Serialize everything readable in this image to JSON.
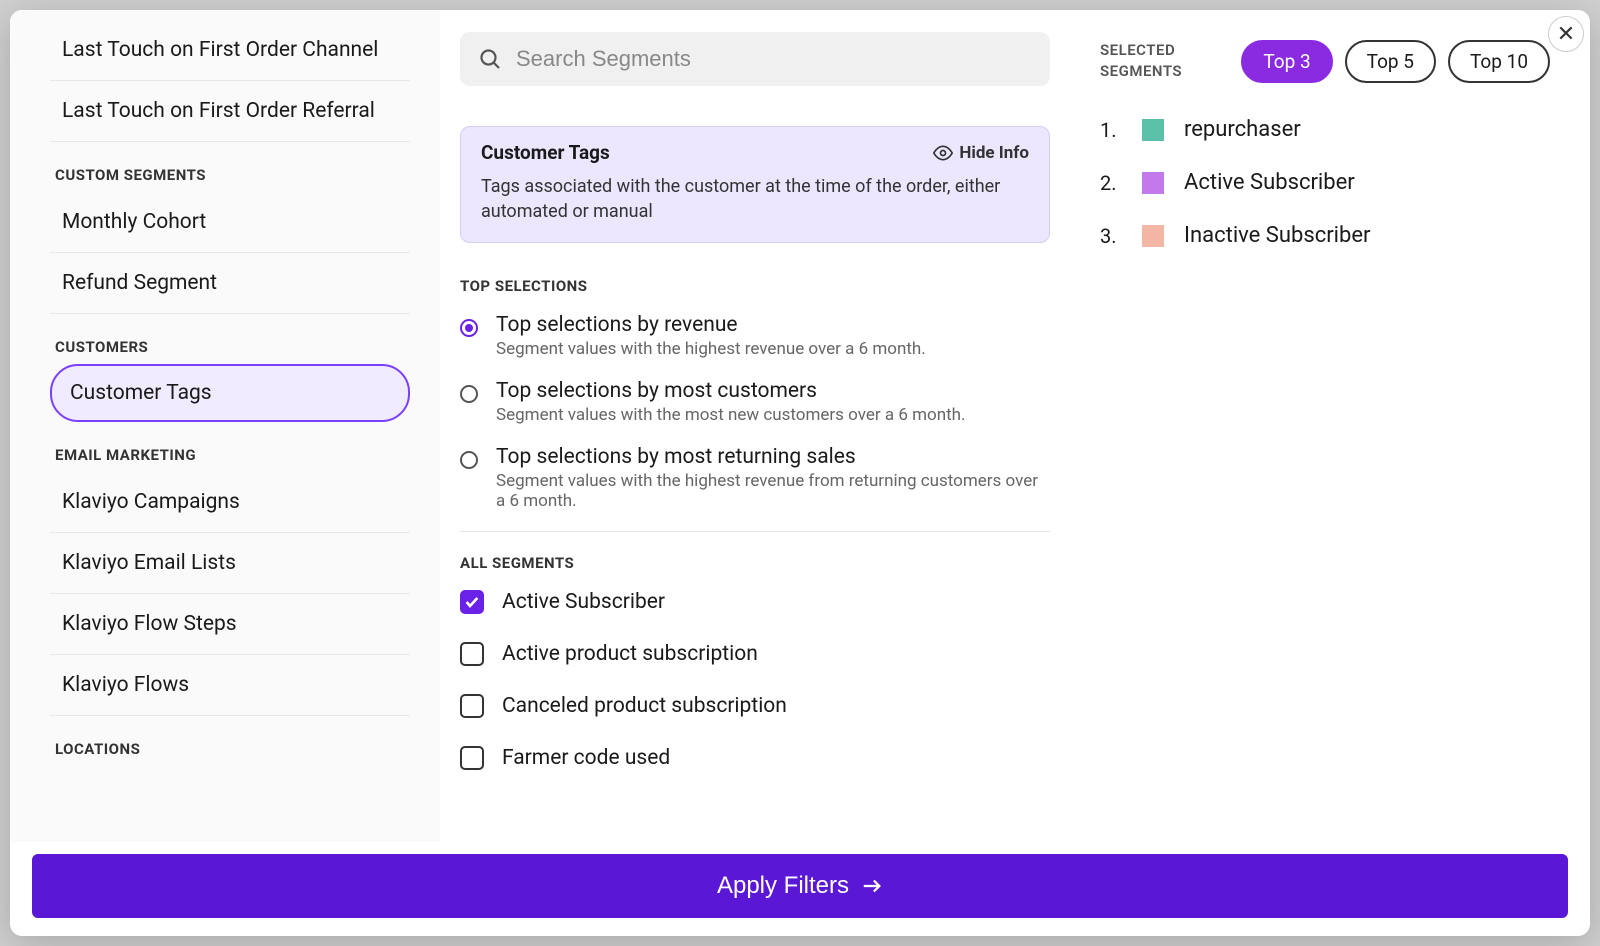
{
  "search": {
    "placeholder": "Search Segments"
  },
  "sidebar": {
    "items_top": [
      "Last Touch on First Order Channel",
      "Last Touch on First Order Referral"
    ],
    "heading_custom": "CUSTOM SEGMENTS",
    "items_custom": [
      "Monthly Cohort",
      "Refund Segment"
    ],
    "heading_customers": "CUSTOMERS",
    "item_customers_active": "Customer Tags",
    "heading_email": "EMAIL MARKETING",
    "items_email": [
      "Klaviyo Campaigns",
      "Klaviyo Email Lists",
      "Klaviyo Flow Steps",
      "Klaviyo Flows"
    ],
    "heading_locations": "LOCATIONS"
  },
  "info_card": {
    "title": "Customer Tags",
    "hide_label": "Hide Info",
    "description": "Tags associated with the customer at the time of the order, either automated or manual"
  },
  "top_selections": {
    "heading": "TOP SELECTIONS",
    "options": [
      {
        "title": "Top selections by revenue",
        "desc": "Segment values with the highest revenue over a 6 month.",
        "checked": true
      },
      {
        "title": "Top selections by most customers",
        "desc": "Segment values with the most new customers over a 6 month.",
        "checked": false
      },
      {
        "title": "Top selections by most returning sales",
        "desc": "Segment values with the highest revenue from returning customers over a 6 month.",
        "checked": false
      }
    ]
  },
  "all_segments": {
    "heading": "ALL SEGMENTS",
    "items": [
      {
        "label": "Active Subscriber",
        "checked": true
      },
      {
        "label": "Active product subscription",
        "checked": false
      },
      {
        "label": "Canceled product subscription",
        "checked": false
      },
      {
        "label": "Farmer code used",
        "checked": false
      }
    ]
  },
  "selected": {
    "label_line1": "SELECTED",
    "label_line2": "SEGMENTS",
    "pills": [
      {
        "label": "Top 3",
        "active": true
      },
      {
        "label": "Top 5",
        "active": false
      },
      {
        "label": "Top 10",
        "active": false
      }
    ],
    "rows": [
      {
        "num": "1.",
        "color": "#5ac0a8",
        "name": "repurchaser"
      },
      {
        "num": "2.",
        "color": "#c27aeb",
        "name": "Active Subscriber"
      },
      {
        "num": "3.",
        "color": "#f3b6a4",
        "name": "Inactive Subscriber"
      }
    ]
  },
  "footer": {
    "apply_label": "Apply Filters"
  }
}
